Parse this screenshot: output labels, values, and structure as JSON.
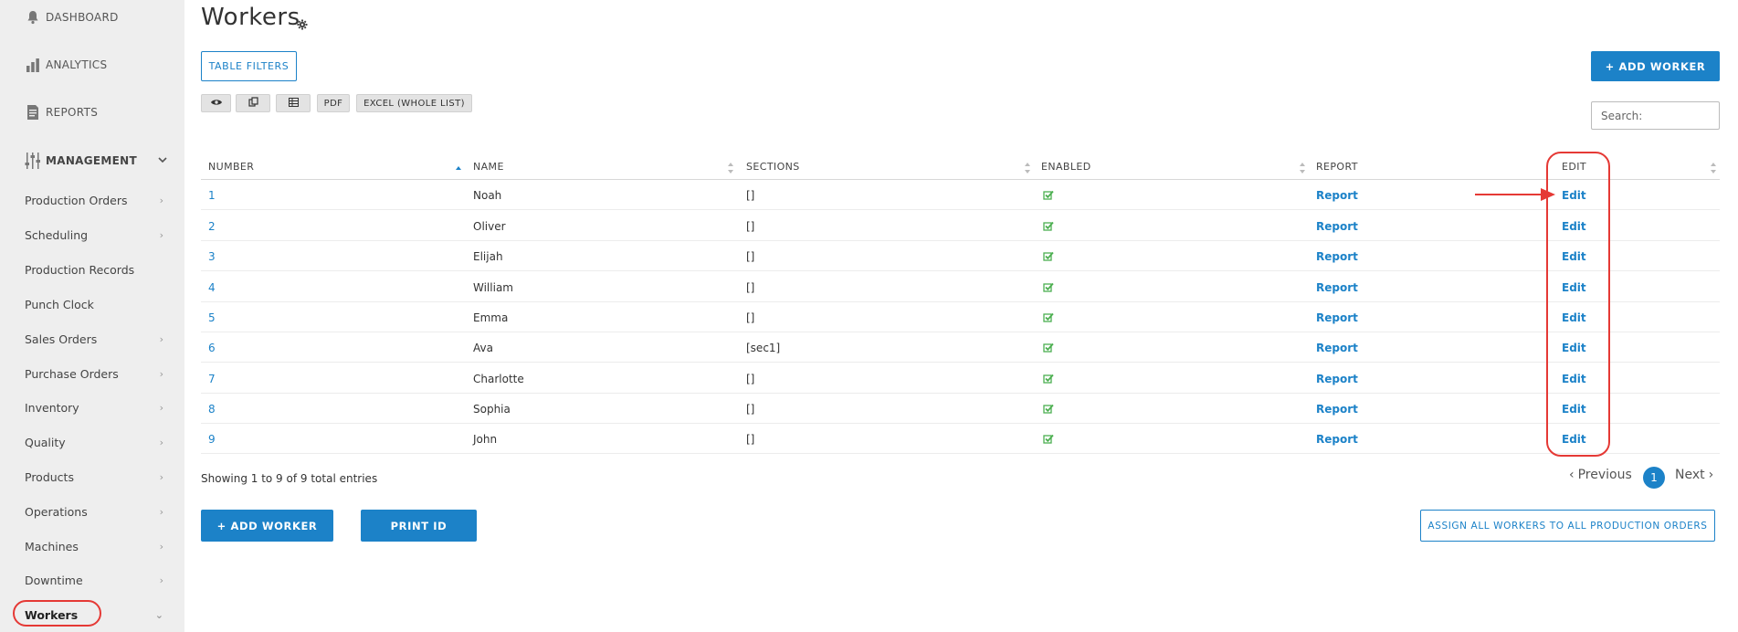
{
  "sidebar": {
    "top_items": [
      {
        "label": "DASHBOARD",
        "icon": "bell-icon"
      },
      {
        "label": "ANALYTICS",
        "icon": "bar-chart-icon"
      },
      {
        "label": "REPORTS",
        "icon": "document-icon"
      }
    ],
    "section": {
      "label": "MANAGEMENT",
      "icon": "sliders-icon"
    },
    "items": [
      {
        "label": "Production Orders",
        "has_arrow": true
      },
      {
        "label": "Scheduling",
        "has_arrow": true
      },
      {
        "label": "Production Records",
        "has_arrow": false
      },
      {
        "label": "Punch Clock",
        "has_arrow": false
      },
      {
        "label": "Sales Orders",
        "has_arrow": true
      },
      {
        "label": "Purchase Orders",
        "has_arrow": true
      },
      {
        "label": "Inventory",
        "has_arrow": true
      },
      {
        "label": "Quality",
        "has_arrow": true
      },
      {
        "label": "Products",
        "has_arrow": true
      },
      {
        "label": "Operations",
        "has_arrow": true
      },
      {
        "label": "Machines",
        "has_arrow": true
      },
      {
        "label": "Downtime",
        "has_arrow": true
      },
      {
        "label": "Workers",
        "has_arrow": true,
        "active": true
      }
    ]
  },
  "page": {
    "title": "Workers",
    "table_filters_label": "TABLE FILTERS",
    "add_worker_top_label": "+ ADD WORKER",
    "export_buttons": [
      {
        "label": "",
        "icon": "eye-icon"
      },
      {
        "label": "",
        "icon": "copy-icon"
      },
      {
        "label": "",
        "icon": "csv-icon"
      },
      {
        "label": "PDF",
        "icon": ""
      },
      {
        "label": "EXCEL (WHOLE LIST)",
        "icon": ""
      }
    ],
    "search_placeholder": "Search:"
  },
  "table": {
    "columns": [
      "NUMBER",
      "NAME",
      "SECTIONS",
      "ENABLED",
      "REPORT",
      "EDIT"
    ],
    "rows": [
      {
        "number": "1",
        "name": "Noah",
        "sections": "[]",
        "enabled": true,
        "report": "Report",
        "edit": "Edit"
      },
      {
        "number": "2",
        "name": "Oliver",
        "sections": "[]",
        "enabled": true,
        "report": "Report",
        "edit": "Edit"
      },
      {
        "number": "3",
        "name": "Elijah",
        "sections": "[]",
        "enabled": true,
        "report": "Report",
        "edit": "Edit"
      },
      {
        "number": "4",
        "name": "William",
        "sections": "[]",
        "enabled": true,
        "report": "Report",
        "edit": "Edit"
      },
      {
        "number": "5",
        "name": "Emma",
        "sections": "[]",
        "enabled": true,
        "report": "Report",
        "edit": "Edit"
      },
      {
        "number": "6",
        "name": "Ava",
        "sections": "[sec1]",
        "enabled": true,
        "report": "Report",
        "edit": "Edit"
      },
      {
        "number": "7",
        "name": "Charlotte",
        "sections": "[]",
        "enabled": true,
        "report": "Report",
        "edit": "Edit"
      },
      {
        "number": "8",
        "name": "Sophia",
        "sections": "[]",
        "enabled": true,
        "report": "Report",
        "edit": "Edit"
      },
      {
        "number": "9",
        "name": "John",
        "sections": "[]",
        "enabled": true,
        "report": "Report",
        "edit": "Edit"
      }
    ]
  },
  "footer": {
    "showing": "Showing 1 to 9 of 9 total entries",
    "previous": "Previous",
    "current_page": "1",
    "next": "Next",
    "add_worker_label": "+ ADD WORKER",
    "print_id_label": "PRINT ID",
    "assign_all_label": "ASSIGN ALL WORKERS TO ALL PRODUCTION ORDERS"
  },
  "colors": {
    "accent": "#1c82c8",
    "annotation": "#e53935",
    "check": "#4caf50",
    "sidebar_bg": "#eeeeee"
  }
}
